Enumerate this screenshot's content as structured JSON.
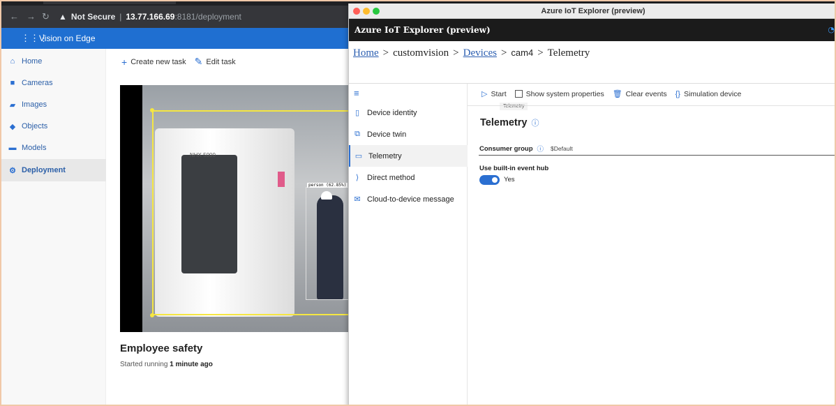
{
  "browser": {
    "security_label": "Not Secure",
    "url_host": "13.77.166.69",
    "url_path": ":8181/deployment"
  },
  "voe": {
    "app_title": "Vision on Edge",
    "nav": [
      {
        "label": "Home",
        "icon": "home-icon"
      },
      {
        "label": "Cameras",
        "icon": "camera-icon"
      },
      {
        "label": "Images",
        "icon": "images-icon"
      },
      {
        "label": "Objects",
        "icon": "objects-icon"
      },
      {
        "label": "Models",
        "icon": "models-icon"
      },
      {
        "label": "Deployment",
        "icon": "deployment-icon"
      }
    ],
    "commands": {
      "create": "Create new task",
      "edit": "Edit task"
    },
    "video": {
      "detection_label": "person (62.85%)",
      "machine_brand": "NHX 5000"
    },
    "task": {
      "title": "Employee safety",
      "status_prefix": "Started running",
      "status_time": "1 minute ago"
    }
  },
  "iot": {
    "window_title": "Azure IoT Explorer (preview)",
    "app_title": "Azure IoT Explorer (preview)",
    "breadcrumb": {
      "home": "Home",
      "hub": "customvision",
      "devices": "Devices",
      "device": "cam4",
      "page": "Telemetry",
      "sep": ">"
    },
    "nav": [
      {
        "label": "Device identity"
      },
      {
        "label": "Device twin"
      },
      {
        "label": "Telemetry"
      },
      {
        "label": "Direct method"
      },
      {
        "label": "Cloud-to-device message"
      }
    ],
    "commands": {
      "start": "Start",
      "show_system": "Show system properties",
      "clear": "Clear events",
      "simulation": "Simulation device"
    },
    "tooltip": "Telemetry",
    "telemetry_title": "Telemetry",
    "consumer_group_label": "Consumer group",
    "consumer_group_value": "$Default",
    "builtin_label": "Use built-in event hub",
    "builtin_value": "Yes",
    "builtin_enabled": true
  },
  "colors": {
    "voe_header": "#1f6fd1",
    "accent": "#2b6fd1",
    "bbox": "#f5e642",
    "iot_appbar": "#1b1b1b"
  }
}
